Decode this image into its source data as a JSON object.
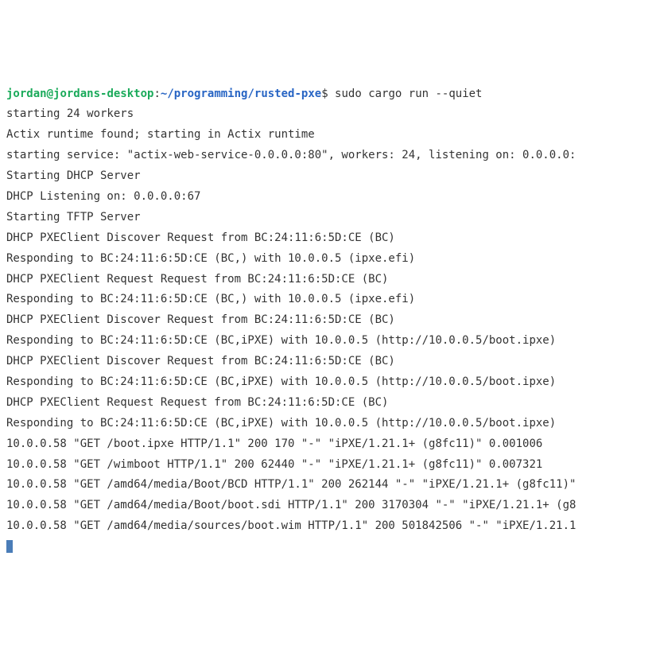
{
  "prompt": {
    "user": "jordan",
    "at": "@",
    "host": "jordans-desktop",
    "colon": ":",
    "path": "~/programming/rusted-pxe",
    "dollar": "$",
    "command": " sudo cargo run --quiet"
  },
  "output": [
    "starting 24 workers",
    "Actix runtime found; starting in Actix runtime",
    "starting service: \"actix-web-service-0.0.0.0:80\", workers: 24, listening on: 0.0.0.0:",
    "Starting DHCP Server",
    "DHCP Listening on: 0.0.0.0:67",
    "Starting TFTP Server",
    "DHCP PXEClient Discover Request from BC:24:11:6:5D:CE (BC)",
    "Responding to BC:24:11:6:5D:CE (BC,) with 10.0.0.5 (ipxe.efi)",
    "DHCP PXEClient Request Request from BC:24:11:6:5D:CE (BC)",
    "Responding to BC:24:11:6:5D:CE (BC,) with 10.0.0.5 (ipxe.efi)",
    "DHCP PXEClient Discover Request from BC:24:11:6:5D:CE (BC)",
    "Responding to BC:24:11:6:5D:CE (BC,iPXE) with 10.0.0.5 (http://10.0.0.5/boot.ipxe)",
    "DHCP PXEClient Discover Request from BC:24:11:6:5D:CE (BC)",
    "Responding to BC:24:11:6:5D:CE (BC,iPXE) with 10.0.0.5 (http://10.0.0.5/boot.ipxe)",
    "DHCP PXEClient Request Request from BC:24:11:6:5D:CE (BC)",
    "Responding to BC:24:11:6:5D:CE (BC,iPXE) with 10.0.0.5 (http://10.0.0.5/boot.ipxe)",
    "10.0.0.58 \"GET /boot.ipxe HTTP/1.1\" 200 170 \"-\" \"iPXE/1.21.1+ (g8fc11)\" 0.001006",
    "10.0.0.58 \"GET /wimboot HTTP/1.1\" 200 62440 \"-\" \"iPXE/1.21.1+ (g8fc11)\" 0.007321",
    "10.0.0.58 \"GET /amd64/media/Boot/BCD HTTP/1.1\" 200 262144 \"-\" \"iPXE/1.21.1+ (g8fc11)\"",
    "10.0.0.58 \"GET /amd64/media/Boot/boot.sdi HTTP/1.1\" 200 3170304 \"-\" \"iPXE/1.21.1+ (g8",
    "10.0.0.58 \"GET /amd64/media/sources/boot.wim HTTP/1.1\" 200 501842506 \"-\" \"iPXE/1.21.1"
  ]
}
